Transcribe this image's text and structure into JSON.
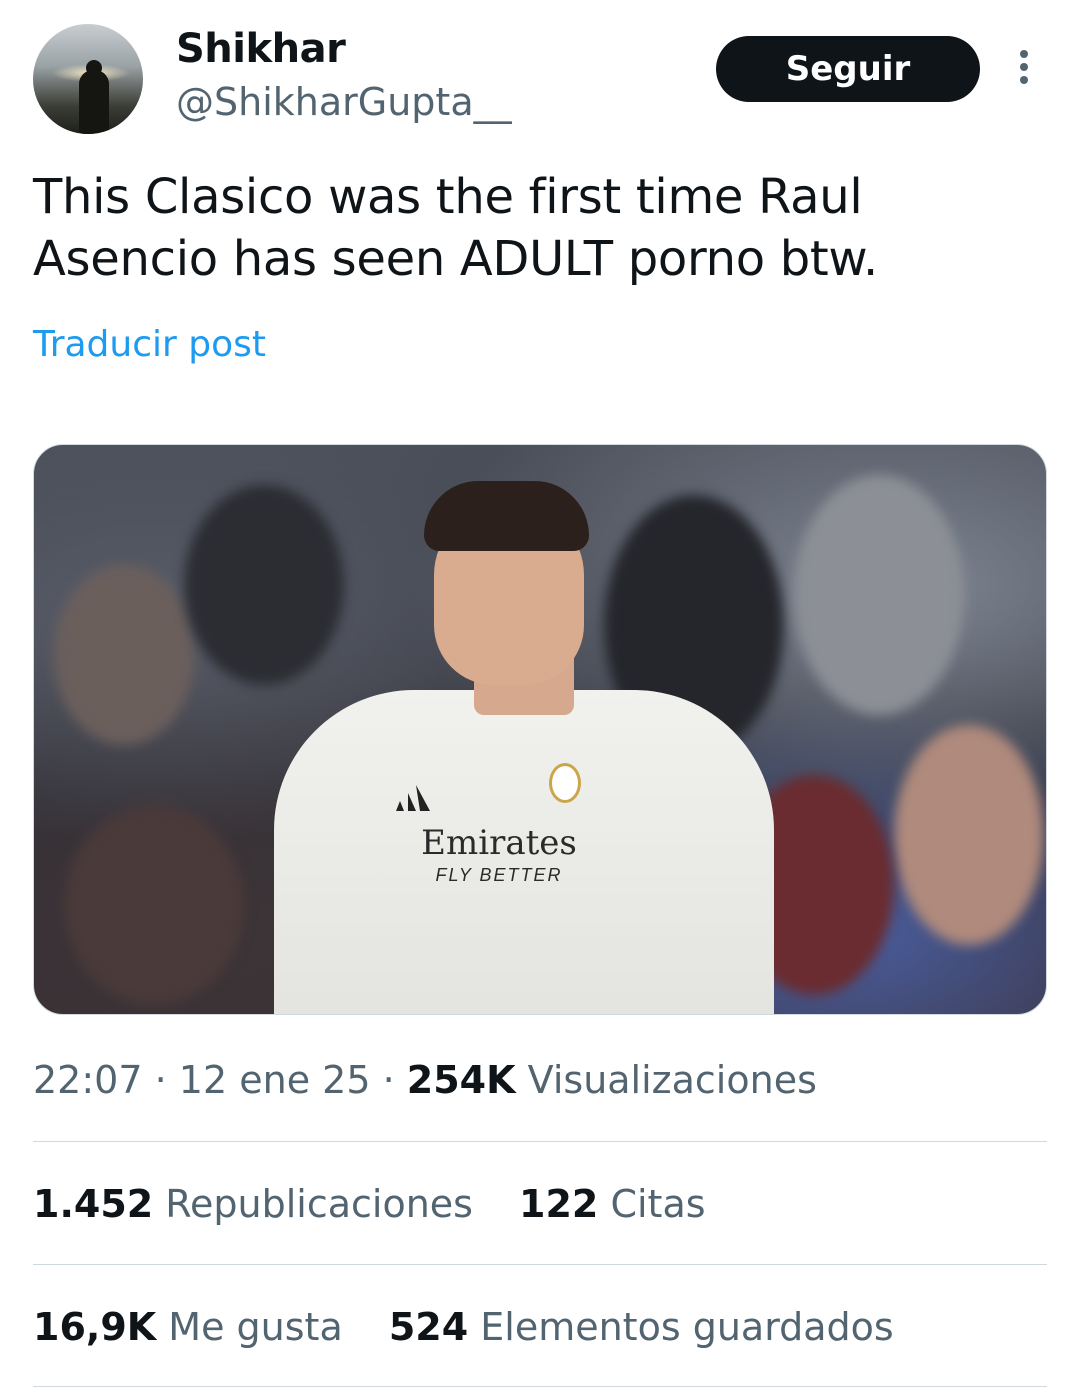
{
  "author": {
    "name": "Shikhar",
    "handle": "@ShikharGupta__"
  },
  "follow_button": {
    "label": "Seguir"
  },
  "more_icon": "more-vertical-icon",
  "tweet": {
    "text": "This Clasico was the first time Raul Asencio has seen ADULT porno btw.",
    "translate_label": "Traducir post"
  },
  "media": {
    "shirt_sponsor": "Emirates",
    "shirt_tagline": "FLY BETTER"
  },
  "meta": {
    "time": "22:07",
    "date": "12 ene 25",
    "separator": "·",
    "views_count": "254K",
    "views_label": "Visualizaciones"
  },
  "stats": {
    "reposts_count": "1.452",
    "reposts_label": "Republicaciones",
    "quotes_count": "122",
    "quotes_label": "Citas",
    "likes_count": "16,9K",
    "likes_label": "Me gusta",
    "bookmarks_count": "524",
    "bookmarks_label": "Elementos guardados"
  },
  "colors": {
    "link": "#1d9bf0",
    "secondary_text": "#536471",
    "primary_text": "#0f1419",
    "divider": "#cfd9de"
  }
}
